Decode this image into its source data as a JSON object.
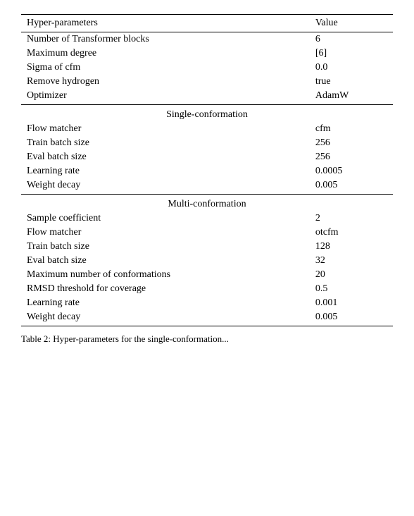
{
  "table": {
    "columns": {
      "param": "Hyper-parameters",
      "value": "Value"
    },
    "top_section": {
      "rows": [
        {
          "param": "Number of Transformer blocks",
          "value": "6"
        },
        {
          "param": "Maximum degree",
          "value": "[6]"
        },
        {
          "param": "Sigma of cfm",
          "value": "0.0"
        },
        {
          "param": "Remove hydrogen",
          "value": "true"
        },
        {
          "param": "Optimizer",
          "value": "AdamW"
        }
      ]
    },
    "single_conformation": {
      "header": "Single-conformation",
      "rows": [
        {
          "param": "Flow matcher",
          "value": "cfm"
        },
        {
          "param": "Train batch size",
          "value": "256"
        },
        {
          "param": "Eval batch size",
          "value": "256"
        },
        {
          "param": "Learning rate",
          "value": "0.0005"
        },
        {
          "param": "Weight decay",
          "value": "0.005"
        }
      ]
    },
    "multi_conformation": {
      "header": "Multi-conformation",
      "rows": [
        {
          "param": "Sample coefficient",
          "value": "2"
        },
        {
          "param": "Flow matcher",
          "value": "otcfm"
        },
        {
          "param": "Train batch size",
          "value": "128"
        },
        {
          "param": "Eval batch size",
          "value": "32"
        },
        {
          "param": "Maximum number of conformations",
          "value": "20"
        },
        {
          "param": "RMSD threshold for coverage",
          "value": "0.5"
        },
        {
          "param": "Learning rate",
          "value": "0.001"
        },
        {
          "param": "Weight decay",
          "value": "0.005"
        }
      ]
    }
  },
  "caption": "Table 2: Hyper-parameters for the single-conformation..."
}
